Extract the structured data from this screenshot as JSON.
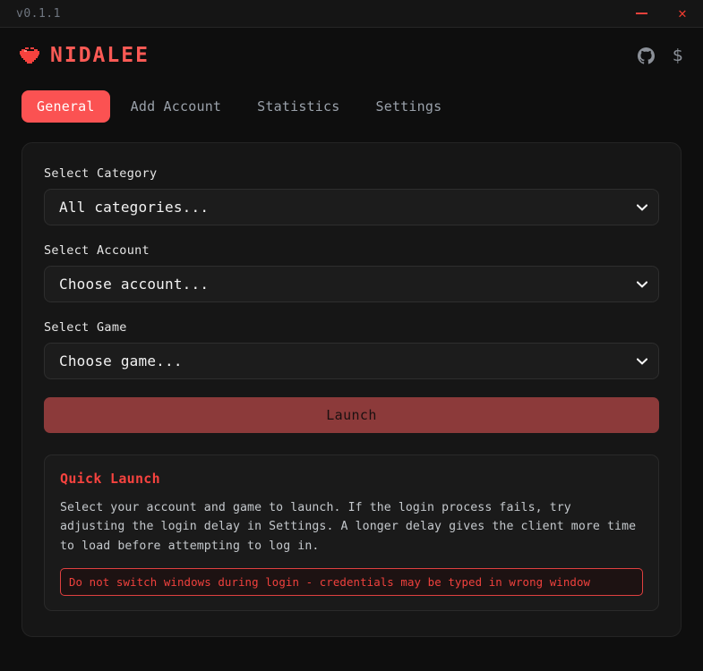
{
  "titlebar": {
    "version": "v0.1.1",
    "minimize_label": "minimize",
    "close_label": "✕"
  },
  "header": {
    "brand": "NIDALEE",
    "icons": [
      {
        "name": "github-icon",
        "label": "GitHub"
      },
      {
        "name": "dollar-icon",
        "label": "$"
      }
    ]
  },
  "tabs": [
    {
      "label": "General",
      "active": true
    },
    {
      "label": "Add Account",
      "active": false
    },
    {
      "label": "Statistics",
      "active": false
    },
    {
      "label": "Settings",
      "active": false
    }
  ],
  "form": {
    "category": {
      "label": "Select Category",
      "value": "All categories..."
    },
    "account": {
      "label": "Select Account",
      "value": "Choose account..."
    },
    "game": {
      "label": "Select Game",
      "value": "Choose game..."
    },
    "launch_label": "Launch"
  },
  "quick_launch": {
    "title": "Quick Launch",
    "body": "Select your account and game to launch. If the login process fails, try adjusting the login delay in Settings. A longer delay gives the client more time to load before attempting to log in.",
    "warning": "Do not switch windows during login - credentials may be typed in wrong window"
  },
  "colors": {
    "accent": "#fb5252",
    "brand": "#fb5a55",
    "warning": "#f0413d",
    "launch_disabled": "#8c3a3a",
    "page_bg": "#0e0e0e",
    "card_bg": "#161616"
  }
}
